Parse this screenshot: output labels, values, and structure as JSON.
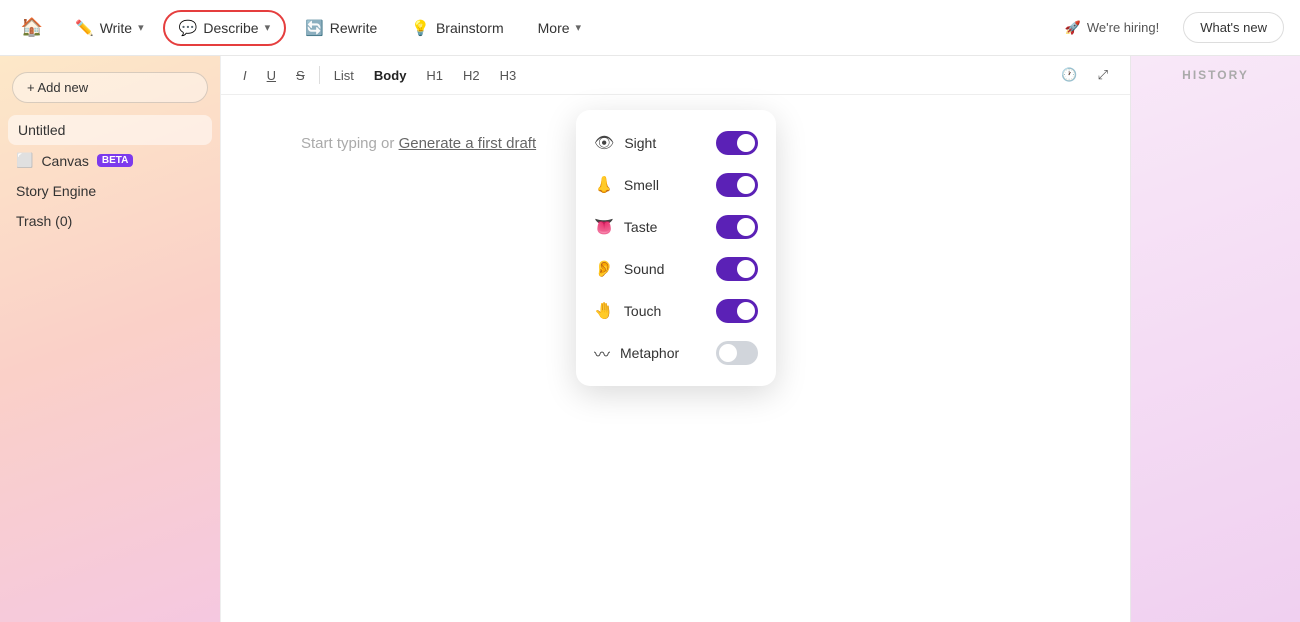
{
  "topbar": {
    "home_icon": "🏠",
    "buttons": [
      {
        "id": "write",
        "label": "Write",
        "icon": "✏️",
        "has_chevron": true,
        "active": false
      },
      {
        "id": "describe",
        "label": "Describe",
        "icon": "💬",
        "has_chevron": true,
        "active": true
      },
      {
        "id": "rewrite",
        "label": "Rewrite",
        "icon": "🔄",
        "has_chevron": false,
        "active": false
      },
      {
        "id": "brainstorm",
        "label": "Brainstorm",
        "icon": "💡",
        "has_chevron": false,
        "active": false
      },
      {
        "id": "more",
        "label": "More",
        "icon": "",
        "has_chevron": true,
        "active": false
      }
    ],
    "hiring_label": "We're hiring!",
    "whats_new_label": "What's new"
  },
  "sidebar": {
    "add_btn_label": "+ Add new",
    "items": [
      {
        "id": "untitled",
        "label": "Untitled",
        "icon": "",
        "active": true,
        "badge": ""
      },
      {
        "id": "canvas",
        "label": "Canvas",
        "icon": "⬜",
        "active": false,
        "badge": "BETA"
      },
      {
        "id": "story-engine",
        "label": "Story Engine",
        "icon": "",
        "active": false,
        "badge": ""
      },
      {
        "id": "trash",
        "label": "Trash (0)",
        "icon": "",
        "active": false,
        "badge": ""
      }
    ]
  },
  "editor": {
    "toolbar": {
      "italic": "I",
      "underline": "U",
      "strikethrough": "S",
      "list": "List",
      "body": "Body",
      "h1": "H1",
      "h2": "H2",
      "h3": "H3"
    },
    "placeholder": "Start typing or",
    "generate_link": "Generate a first draft"
  },
  "dropdown": {
    "items": [
      {
        "id": "sight",
        "label": "Sight",
        "icon": "👁",
        "enabled": true
      },
      {
        "id": "smell",
        "label": "Smell",
        "icon": "👃",
        "enabled": true
      },
      {
        "id": "taste",
        "label": "Taste",
        "icon": "👅",
        "enabled": true
      },
      {
        "id": "sound",
        "label": "Sound",
        "icon": "👂",
        "enabled": true
      },
      {
        "id": "touch",
        "label": "Touch",
        "icon": "🤚",
        "enabled": true
      },
      {
        "id": "metaphor",
        "label": "Metaphor",
        "icon": "〰",
        "enabled": false
      }
    ]
  },
  "history": {
    "label": "HISTORY"
  }
}
